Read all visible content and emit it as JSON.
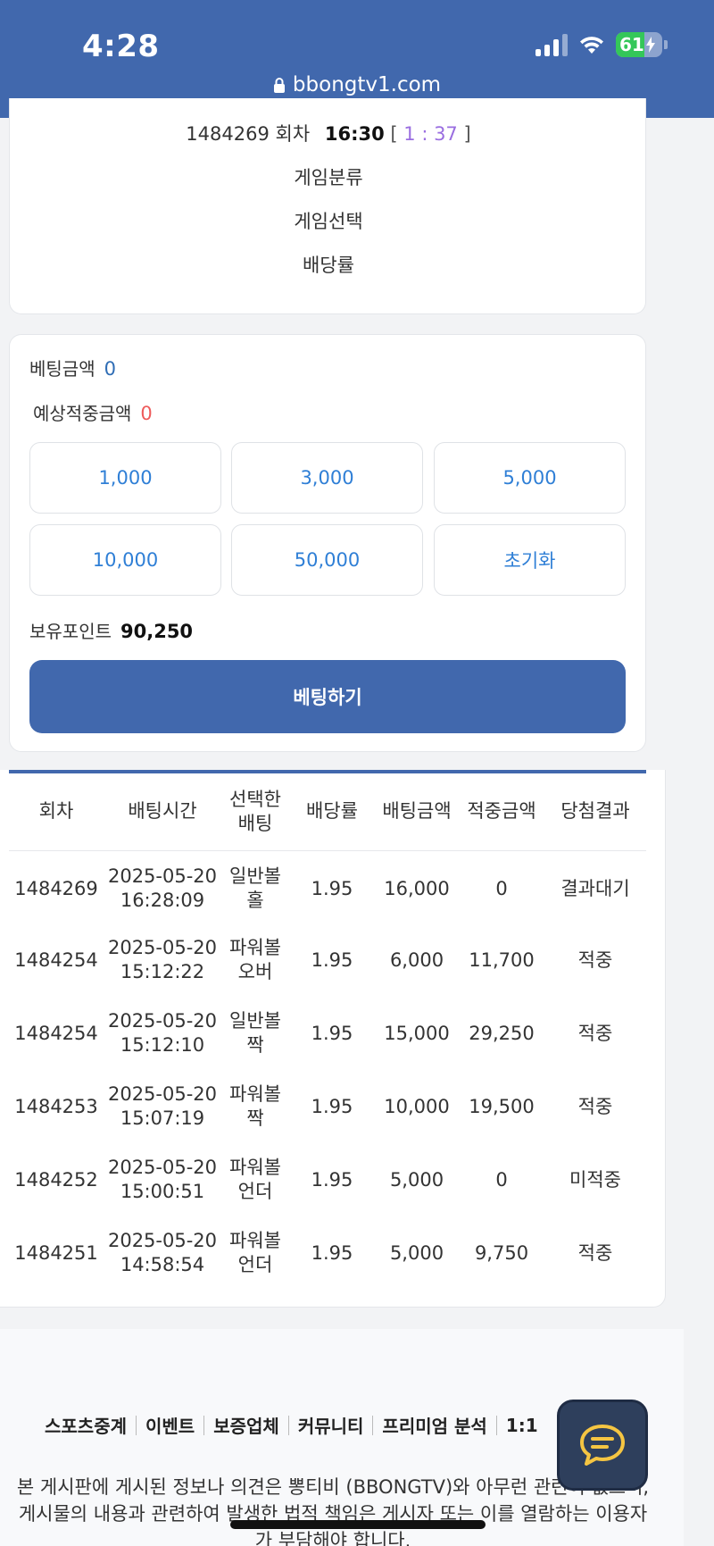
{
  "status_bar": {
    "time": "4:28",
    "battery": "61"
  },
  "url": "bbongtv1.com",
  "game_info": {
    "round_number": "1484269",
    "round_label": "회차",
    "time": "16:30",
    "bracket_open": "[",
    "countdown": "1 : 37",
    "bracket_close": "]",
    "category_label": "게임분류",
    "selection_label": "게임선택",
    "odds_label": "배당률"
  },
  "bet_panel": {
    "bet_amount_label": "베팅금액",
    "bet_amount_value": "0",
    "expected_win_label": "예상적중금액",
    "expected_win_value": "0",
    "amount_buttons": [
      "1,000",
      "3,000",
      "5,000",
      "10,000",
      "50,000"
    ],
    "reset_label": "초기화",
    "points_label": "보유포인트",
    "points_value": "90,250",
    "submit_label": "베팅하기"
  },
  "history": {
    "headers": [
      "회차",
      "배팅시간",
      "선택한배팅",
      "배당률",
      "배팅금액",
      "적중금액",
      "당첨결과"
    ],
    "rows": [
      {
        "round": "1484269",
        "date": "2025-05-20",
        "time": "16:28:09",
        "pick": "일반볼홀",
        "odds": "1.95",
        "bet": "16,000",
        "win": "0",
        "result": "결과대기",
        "status": "wait"
      },
      {
        "round": "1484254",
        "date": "2025-05-20",
        "time": "15:12:22",
        "pick": "파워볼오버",
        "odds": "1.95",
        "bet": "6,000",
        "win": "11,700",
        "result": "적중",
        "status": "hit"
      },
      {
        "round": "1484254",
        "date": "2025-05-20",
        "time": "15:12:10",
        "pick": "일반볼짝",
        "odds": "1.95",
        "bet": "15,000",
        "win": "29,250",
        "result": "적중",
        "status": "hit"
      },
      {
        "round": "1484253",
        "date": "2025-05-20",
        "time": "15:07:19",
        "pick": "파워볼짝",
        "odds": "1.95",
        "bet": "10,000",
        "win": "19,500",
        "result": "적중",
        "status": "hit"
      },
      {
        "round": "1484252",
        "date": "2025-05-20",
        "time": "15:00:51",
        "pick": "파워볼언더",
        "odds": "1.95",
        "bet": "5,000",
        "win": "0",
        "result": "미적중",
        "status": "miss"
      },
      {
        "round": "1484251",
        "date": "2025-05-20",
        "time": "14:58:54",
        "pick": "파워볼언더",
        "odds": "1.95",
        "bet": "5,000",
        "win": "9,750",
        "result": "적중",
        "status": "hit"
      }
    ]
  },
  "footer": {
    "links": [
      "스포츠중계",
      "이벤트",
      "보증업체",
      "커뮤니티",
      "프리미엄 분석",
      "1:1"
    ],
    "disclaimer_line1": "본 게시판에 게시된 정보나 의견은 뽕티비 (BBONGTV)와 아무런 관련이 없으며,",
    "disclaimer_line2": "게시물의 내용과 관련하여 발생한 법적 책임은 게시자 또는 이를 열람하는 이용자",
    "disclaimer_line3": "가 부담해야 합니다."
  },
  "colors": {
    "brand": "#4168ad",
    "hit": "#3b8de0",
    "miss": "#ee5b5b",
    "countdown": "#9a6ee0",
    "amount_blue": "#2f7fd6"
  }
}
